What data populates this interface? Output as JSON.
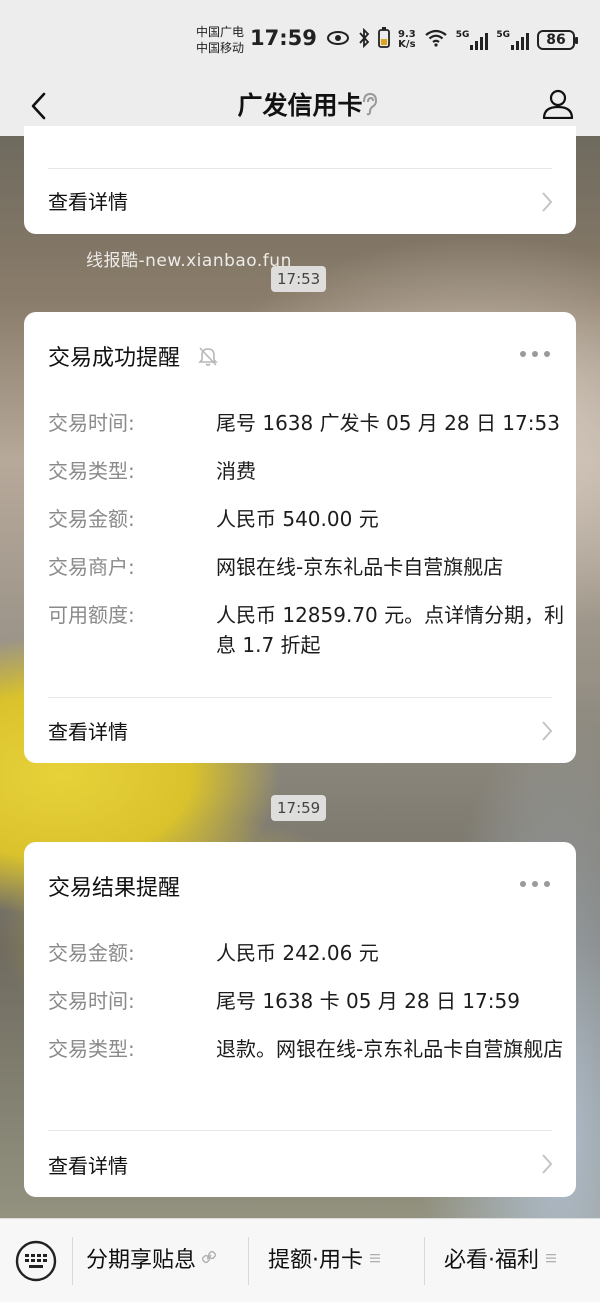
{
  "status_bar": {
    "carrier_line1": "中国广电",
    "carrier_line2": "中国移动",
    "time": "17:59",
    "net_speed_value": "9.3",
    "net_speed_unit": "K/s",
    "sim1_tag": "5G",
    "sim2_tag": "5G",
    "battery": "86"
  },
  "nav": {
    "title": "广发信用卡",
    "back_icon": "chevron-left-icon",
    "ear_icon": "ear-icon",
    "profile_icon": "person-icon"
  },
  "watermark": "线报酷-new.xianbao.fun",
  "card_partial": {
    "detail_label": "查看详情"
  },
  "chips": {
    "time_1": "17:53",
    "time_2": "17:59"
  },
  "card1": {
    "title": "交易成功提醒",
    "rows": [
      {
        "label": "交易时间:",
        "value": "尾号 1638 广发卡 05 月 28 日 17:53"
      },
      {
        "label": "交易类型:",
        "value": "消费"
      },
      {
        "label": "交易金额:",
        "value": "人民币 540.00 元"
      },
      {
        "label": "交易商户:",
        "value": "网银在线-京东礼品卡自营旗舰店"
      },
      {
        "label": "可用额度:",
        "value": "人民币 12859.70 元。点详情分期，利息 1.7 折起"
      }
    ],
    "detail_label": "查看详情"
  },
  "card2": {
    "title": "交易结果提醒",
    "rows": [
      {
        "label": "交易金额:",
        "value": "人民币 242.06 元"
      },
      {
        "label": "交易时间:",
        "value": "尾号 1638 卡 05 月 28 日 17:59"
      },
      {
        "label": "交易类型:",
        "value": "退款。网银在线-京东礼品卡自营旗舰店"
      }
    ],
    "detail_label": "查看详情"
  },
  "bottom_menu": {
    "items": [
      {
        "label": "分期享贴息",
        "icon": "link-icon"
      },
      {
        "label": "提额·用卡",
        "icon": "menu-lines-icon"
      },
      {
        "label": "必看·福利",
        "icon": "menu-lines-icon"
      }
    ]
  },
  "colors": {
    "page_bg": "#ededed",
    "card_bg": "#ffffff",
    "label_gray": "#8a8a8a",
    "text_dark": "#111111"
  }
}
